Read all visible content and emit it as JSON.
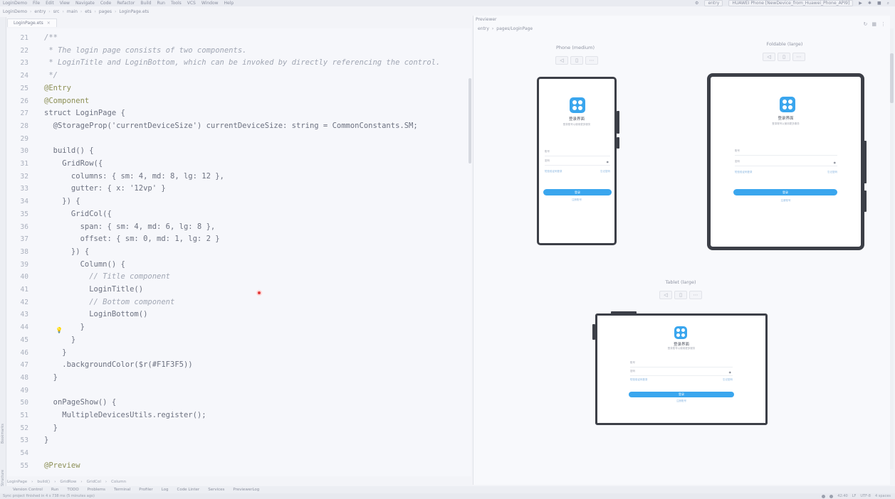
{
  "menubar": {
    "project": "LoginDemo",
    "items": [
      "File",
      "Edit",
      "View",
      "Navigate",
      "Code",
      "Refactor",
      "Build",
      "Run",
      "Tools",
      "VCS",
      "Window",
      "Help"
    ],
    "run_config": "entry",
    "device": "HUAWEI Phone [NewDevice_from_Huawei_Phone_API9]"
  },
  "breadcrumb": [
    "LoginDemo",
    "entry",
    "src",
    "main",
    "ets",
    "pages",
    "LoginPage.ets"
  ],
  "editor": {
    "tab": "LoginPage.ets",
    "lines": [
      {
        "n": "21",
        "t": "/**",
        "k": "comment"
      },
      {
        "n": "22",
        "t": " * The login page consists of two components.",
        "k": "comment"
      },
      {
        "n": "23",
        "t": " * LoginTitle and LoginBottom, which can be invoked by directly referencing the control.",
        "k": "comment"
      },
      {
        "n": "24",
        "t": " */",
        "k": "comment"
      },
      {
        "n": "25",
        "t": "@Entry",
        "k": "anno"
      },
      {
        "n": "26",
        "t": "@Component",
        "k": "anno"
      },
      {
        "n": "27",
        "t": "struct LoginPage {",
        "k": "code"
      },
      {
        "n": "28",
        "t": "  @StorageProp('currentDeviceSize') currentDeviceSize: string = CommonConstants.SM;",
        "k": "code"
      },
      {
        "n": "29",
        "t": "",
        "k": "code"
      },
      {
        "n": "30",
        "t": "  build() {",
        "k": "code"
      },
      {
        "n": "31",
        "t": "    GridRow({",
        "k": "code"
      },
      {
        "n": "32",
        "t": "      columns: { sm: 4, md: 8, lg: 12 },",
        "k": "code"
      },
      {
        "n": "33",
        "t": "      gutter: { x: '12vp' }",
        "k": "code"
      },
      {
        "n": "34",
        "t": "    }) {",
        "k": "code"
      },
      {
        "n": "35",
        "t": "      GridCol({",
        "k": "code"
      },
      {
        "n": "36",
        "t": "        span: { sm: 4, md: 6, lg: 8 },",
        "k": "code"
      },
      {
        "n": "37",
        "t": "        offset: { sm: 0, md: 1, lg: 2 }",
        "k": "code"
      },
      {
        "n": "38",
        "t": "      }) {",
        "k": "code"
      },
      {
        "n": "39",
        "t": "        Column() {",
        "k": "code"
      },
      {
        "n": "40",
        "t": "          // Title component",
        "k": "comment"
      },
      {
        "n": "41",
        "t": "          LoginTitle()",
        "k": "code"
      },
      {
        "n": "42",
        "t": "          // Bottom component",
        "k": "comment"
      },
      {
        "n": "43",
        "t": "          LoginBottom()",
        "k": "code"
      },
      {
        "n": "44",
        "t": "        }",
        "k": "code"
      },
      {
        "n": "45",
        "t": "      }",
        "k": "code"
      },
      {
        "n": "46",
        "t": "    }",
        "k": "code"
      },
      {
        "n": "47",
        "t": "    .backgroundColor($r(#F1F3F5))",
        "k": "code"
      },
      {
        "n": "48",
        "t": "  }",
        "k": "code"
      },
      {
        "n": "49",
        "t": "",
        "k": "code"
      },
      {
        "n": "50",
        "t": "  onPageShow() {",
        "k": "code"
      },
      {
        "n": "51",
        "t": "    MultipleDevicesUtils.register();",
        "k": "code"
      },
      {
        "n": "52",
        "t": "  }",
        "k": "code"
      },
      {
        "n": "53",
        "t": "}",
        "k": "code"
      },
      {
        "n": "54",
        "t": "",
        "k": "code"
      },
      {
        "n": "55",
        "t": "@Preview",
        "k": "anno"
      }
    ]
  },
  "code_crumbs": [
    "LoginPage",
    "build()",
    "GridRow",
    "GridCol",
    "Column"
  ],
  "tool_windows": [
    "Version Control",
    "Run",
    "TODO",
    "Problems",
    "Terminal",
    "Profiler",
    "Log",
    "Code Linter",
    "Services",
    "PreviewerLog"
  ],
  "status_text": "Sync project finished in 4 s 738 ms (5 minutes ago)",
  "status_right": [
    "42:40",
    "LF",
    "UTF-8",
    "4 spaces"
  ],
  "previewer": {
    "title": "Previewer",
    "path": [
      "entry",
      "pages/LoginPage"
    ],
    "devices": [
      {
        "label": "Phone (medium)"
      },
      {
        "label": "Foldable (large)"
      },
      {
        "label": "Tablet (large)"
      }
    ],
    "app": {
      "title": "登录界面",
      "subtitle": "登录账号以使用更多服务",
      "account": "账号",
      "password": "密码",
      "sms_login": "短信验证码登录",
      "forgot": "忘记密码",
      "login": "登录",
      "register": "注册账号"
    }
  },
  "colors": {
    "accent": "#3aa6ee",
    "bezel": "#3c3f47",
    "breakpoint": "#e23b3b"
  }
}
